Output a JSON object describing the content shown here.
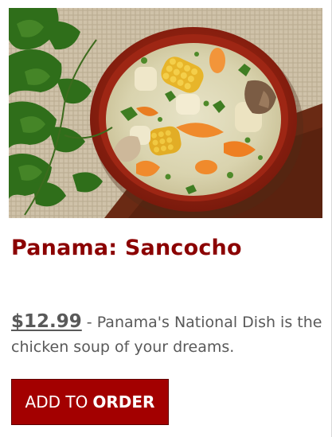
{
  "product": {
    "image_name": "sancocho-soup-photo",
    "title": "Panama: Sancocho",
    "price": "$12.99",
    "description": " - Panama's National Dish is the chicken soup of your dreams.",
    "button": {
      "label_regular": "ADD TO",
      "label_bold": "ORDER"
    }
  },
  "colors": {
    "title": "#8b0000",
    "button_bg": "#a30000",
    "text": "#595959"
  }
}
